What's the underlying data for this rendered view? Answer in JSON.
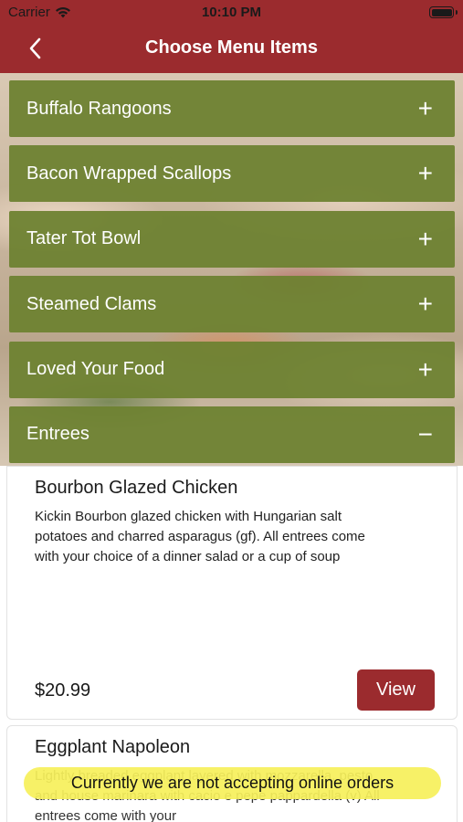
{
  "status_bar": {
    "carrier": "Carrier",
    "time": "10:10 PM",
    "wifi_icon": "wifi-icon",
    "battery_icon": "battery-icon"
  },
  "nav": {
    "title": "Choose Menu Items",
    "back_icon": "chevron-left-icon"
  },
  "colors": {
    "primary": "#9b2b2e",
    "accordion": "#6e8232",
    "banner": "#f6f05a"
  },
  "categories": [
    {
      "label": "Buffalo Rangoons",
      "icon": "+"
    },
    {
      "label": "Bacon Wrapped Scallops",
      "icon": "+"
    },
    {
      "label": "Tater Tot Bowl",
      "icon": "+"
    },
    {
      "label": "Steamed Clams",
      "icon": "+"
    },
    {
      "label": "Loved Your Food",
      "icon": "+"
    },
    {
      "label": "Entrees",
      "icon": "−"
    }
  ],
  "items": [
    {
      "title": "Bourbon Glazed Chicken",
      "description": "Kickin Bourbon glazed chicken with Hungarian salt potatoes and charred asparagus (gf). All entrees come with your choice of a dinner salad or a cup of soup",
      "price": "$20.99",
      "button": "View"
    },
    {
      "title": "Eggplant Napoleon",
      "description": "Lightly breaded eggplant layered with mozzarella, pesto and house marinara with cacio e pepe pappardella (v) All entrees come with your"
    }
  ],
  "banner": "Currently we are not accepting online orders"
}
